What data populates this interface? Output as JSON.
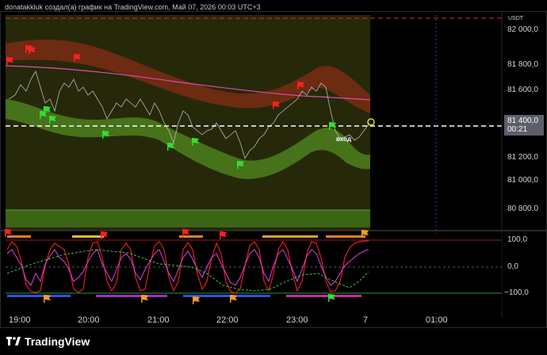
{
  "header": {
    "caption": "donatakkluk создал(а) график на TradingView.com, Май 07, 2026 00:03 UTC+3"
  },
  "price_axis": {
    "currency": "USDT",
    "labels": [
      "82 000,0",
      "81 800,0",
      "81 600,0",
      "81 200,0",
      "81 000,0",
      "80 800,0"
    ],
    "current_price": "81 400,0",
    "countdown": "00:21"
  },
  "osc_axis": {
    "labels": [
      "100,0",
      "0,0",
      "−100,0"
    ]
  },
  "time_axis": {
    "labels": [
      "19:00",
      "20:00",
      "21:00",
      "22:00",
      "23:00",
      "7",
      "01:00"
    ]
  },
  "annotation": {
    "entry_label": "вход"
  },
  "footer": {
    "brand": "TradingView",
    "logo_icon": "tradingview-logo-icon"
  },
  "colors": {
    "background": "#000000",
    "olive_panel": "#26280a",
    "green_band": "#4a7a1c",
    "red_band": "#7a2c14",
    "ma_line": "#d94fa8",
    "price_dashed": "#ffffff",
    "osc_red": "#e02020",
    "osc_magenta": "#e040e0",
    "osc_green": "#3cc23c",
    "flag_red": "#ff2020",
    "flag_green": "#30e030",
    "flag_orange": "#ff9a20",
    "price_tag": "#5d606b"
  }
}
